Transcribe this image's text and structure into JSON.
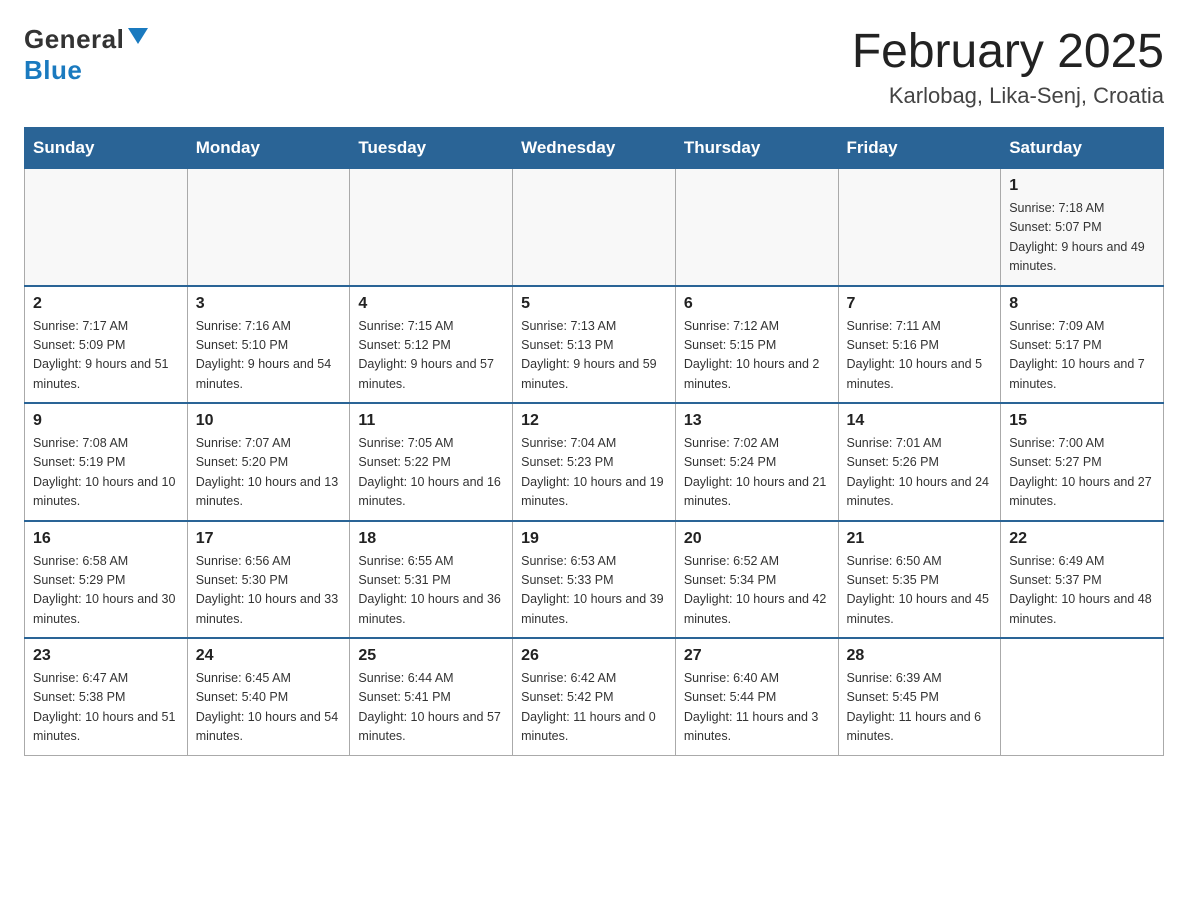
{
  "header": {
    "logo_general": "General",
    "logo_blue": "Blue",
    "title": "February 2025",
    "subtitle": "Karlobag, Lika-Senj, Croatia"
  },
  "weekdays": [
    "Sunday",
    "Monday",
    "Tuesday",
    "Wednesday",
    "Thursday",
    "Friday",
    "Saturday"
  ],
  "weeks": [
    [
      {
        "day": "",
        "sunrise": "",
        "sunset": "",
        "daylight": ""
      },
      {
        "day": "",
        "sunrise": "",
        "sunset": "",
        "daylight": ""
      },
      {
        "day": "",
        "sunrise": "",
        "sunset": "",
        "daylight": ""
      },
      {
        "day": "",
        "sunrise": "",
        "sunset": "",
        "daylight": ""
      },
      {
        "day": "",
        "sunrise": "",
        "sunset": "",
        "daylight": ""
      },
      {
        "day": "",
        "sunrise": "",
        "sunset": "",
        "daylight": ""
      },
      {
        "day": "1",
        "sunrise": "Sunrise: 7:18 AM",
        "sunset": "Sunset: 5:07 PM",
        "daylight": "Daylight: 9 hours and 49 minutes."
      }
    ],
    [
      {
        "day": "2",
        "sunrise": "Sunrise: 7:17 AM",
        "sunset": "Sunset: 5:09 PM",
        "daylight": "Daylight: 9 hours and 51 minutes."
      },
      {
        "day": "3",
        "sunrise": "Sunrise: 7:16 AM",
        "sunset": "Sunset: 5:10 PM",
        "daylight": "Daylight: 9 hours and 54 minutes."
      },
      {
        "day": "4",
        "sunrise": "Sunrise: 7:15 AM",
        "sunset": "Sunset: 5:12 PM",
        "daylight": "Daylight: 9 hours and 57 minutes."
      },
      {
        "day": "5",
        "sunrise": "Sunrise: 7:13 AM",
        "sunset": "Sunset: 5:13 PM",
        "daylight": "Daylight: 9 hours and 59 minutes."
      },
      {
        "day": "6",
        "sunrise": "Sunrise: 7:12 AM",
        "sunset": "Sunset: 5:15 PM",
        "daylight": "Daylight: 10 hours and 2 minutes."
      },
      {
        "day": "7",
        "sunrise": "Sunrise: 7:11 AM",
        "sunset": "Sunset: 5:16 PM",
        "daylight": "Daylight: 10 hours and 5 minutes."
      },
      {
        "day": "8",
        "sunrise": "Sunrise: 7:09 AM",
        "sunset": "Sunset: 5:17 PM",
        "daylight": "Daylight: 10 hours and 7 minutes."
      }
    ],
    [
      {
        "day": "9",
        "sunrise": "Sunrise: 7:08 AM",
        "sunset": "Sunset: 5:19 PM",
        "daylight": "Daylight: 10 hours and 10 minutes."
      },
      {
        "day": "10",
        "sunrise": "Sunrise: 7:07 AM",
        "sunset": "Sunset: 5:20 PM",
        "daylight": "Daylight: 10 hours and 13 minutes."
      },
      {
        "day": "11",
        "sunrise": "Sunrise: 7:05 AM",
        "sunset": "Sunset: 5:22 PM",
        "daylight": "Daylight: 10 hours and 16 minutes."
      },
      {
        "day": "12",
        "sunrise": "Sunrise: 7:04 AM",
        "sunset": "Sunset: 5:23 PM",
        "daylight": "Daylight: 10 hours and 19 minutes."
      },
      {
        "day": "13",
        "sunrise": "Sunrise: 7:02 AM",
        "sunset": "Sunset: 5:24 PM",
        "daylight": "Daylight: 10 hours and 21 minutes."
      },
      {
        "day": "14",
        "sunrise": "Sunrise: 7:01 AM",
        "sunset": "Sunset: 5:26 PM",
        "daylight": "Daylight: 10 hours and 24 minutes."
      },
      {
        "day": "15",
        "sunrise": "Sunrise: 7:00 AM",
        "sunset": "Sunset: 5:27 PM",
        "daylight": "Daylight: 10 hours and 27 minutes."
      }
    ],
    [
      {
        "day": "16",
        "sunrise": "Sunrise: 6:58 AM",
        "sunset": "Sunset: 5:29 PM",
        "daylight": "Daylight: 10 hours and 30 minutes."
      },
      {
        "day": "17",
        "sunrise": "Sunrise: 6:56 AM",
        "sunset": "Sunset: 5:30 PM",
        "daylight": "Daylight: 10 hours and 33 minutes."
      },
      {
        "day": "18",
        "sunrise": "Sunrise: 6:55 AM",
        "sunset": "Sunset: 5:31 PM",
        "daylight": "Daylight: 10 hours and 36 minutes."
      },
      {
        "day": "19",
        "sunrise": "Sunrise: 6:53 AM",
        "sunset": "Sunset: 5:33 PM",
        "daylight": "Daylight: 10 hours and 39 minutes."
      },
      {
        "day": "20",
        "sunrise": "Sunrise: 6:52 AM",
        "sunset": "Sunset: 5:34 PM",
        "daylight": "Daylight: 10 hours and 42 minutes."
      },
      {
        "day": "21",
        "sunrise": "Sunrise: 6:50 AM",
        "sunset": "Sunset: 5:35 PM",
        "daylight": "Daylight: 10 hours and 45 minutes."
      },
      {
        "day": "22",
        "sunrise": "Sunrise: 6:49 AM",
        "sunset": "Sunset: 5:37 PM",
        "daylight": "Daylight: 10 hours and 48 minutes."
      }
    ],
    [
      {
        "day": "23",
        "sunrise": "Sunrise: 6:47 AM",
        "sunset": "Sunset: 5:38 PM",
        "daylight": "Daylight: 10 hours and 51 minutes."
      },
      {
        "day": "24",
        "sunrise": "Sunrise: 6:45 AM",
        "sunset": "Sunset: 5:40 PM",
        "daylight": "Daylight: 10 hours and 54 minutes."
      },
      {
        "day": "25",
        "sunrise": "Sunrise: 6:44 AM",
        "sunset": "Sunset: 5:41 PM",
        "daylight": "Daylight: 10 hours and 57 minutes."
      },
      {
        "day": "26",
        "sunrise": "Sunrise: 6:42 AM",
        "sunset": "Sunset: 5:42 PM",
        "daylight": "Daylight: 11 hours and 0 minutes."
      },
      {
        "day": "27",
        "sunrise": "Sunrise: 6:40 AM",
        "sunset": "Sunset: 5:44 PM",
        "daylight": "Daylight: 11 hours and 3 minutes."
      },
      {
        "day": "28",
        "sunrise": "Sunrise: 6:39 AM",
        "sunset": "Sunset: 5:45 PM",
        "daylight": "Daylight: 11 hours and 6 minutes."
      },
      {
        "day": "",
        "sunrise": "",
        "sunset": "",
        "daylight": ""
      }
    ]
  ]
}
